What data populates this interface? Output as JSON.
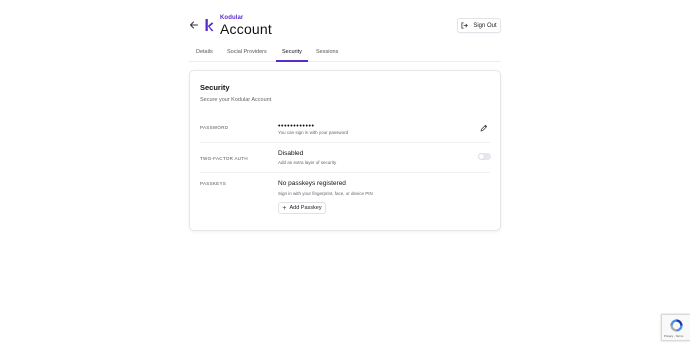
{
  "header": {
    "brand": "Kodular",
    "title": "Account",
    "signout_label": "Sign Out",
    "accent_color": "#5b2bc9"
  },
  "tabs": [
    {
      "label": "Details",
      "active": false
    },
    {
      "label": "Social Providers",
      "active": false
    },
    {
      "label": "Security",
      "active": true
    },
    {
      "label": "Sessions",
      "active": false
    }
  ],
  "security": {
    "title": "Security",
    "subtitle": "Secure your Kodular Account",
    "password": {
      "label": "PASSWORD",
      "value": "••••••••••••",
      "hint": "You can sign in with your password"
    },
    "two_factor": {
      "label": "TWO-FACTOR AUTH",
      "status": "Disabled",
      "hint": "Add an extra layer of security",
      "enabled": false
    },
    "passkeys": {
      "label": "PASSKEYS",
      "status": "No passkeys registered",
      "hint": "Sign in with your fingerprint, face, or device PIN",
      "add_label": "Add Passkey"
    }
  },
  "recaptcha": {
    "text": "Privacy - Terms"
  },
  "icons": [
    "back-arrow-icon",
    "kodular-logo",
    "sign-out-icon",
    "pencil-icon",
    "plus-icon",
    "recaptcha-icon"
  ]
}
